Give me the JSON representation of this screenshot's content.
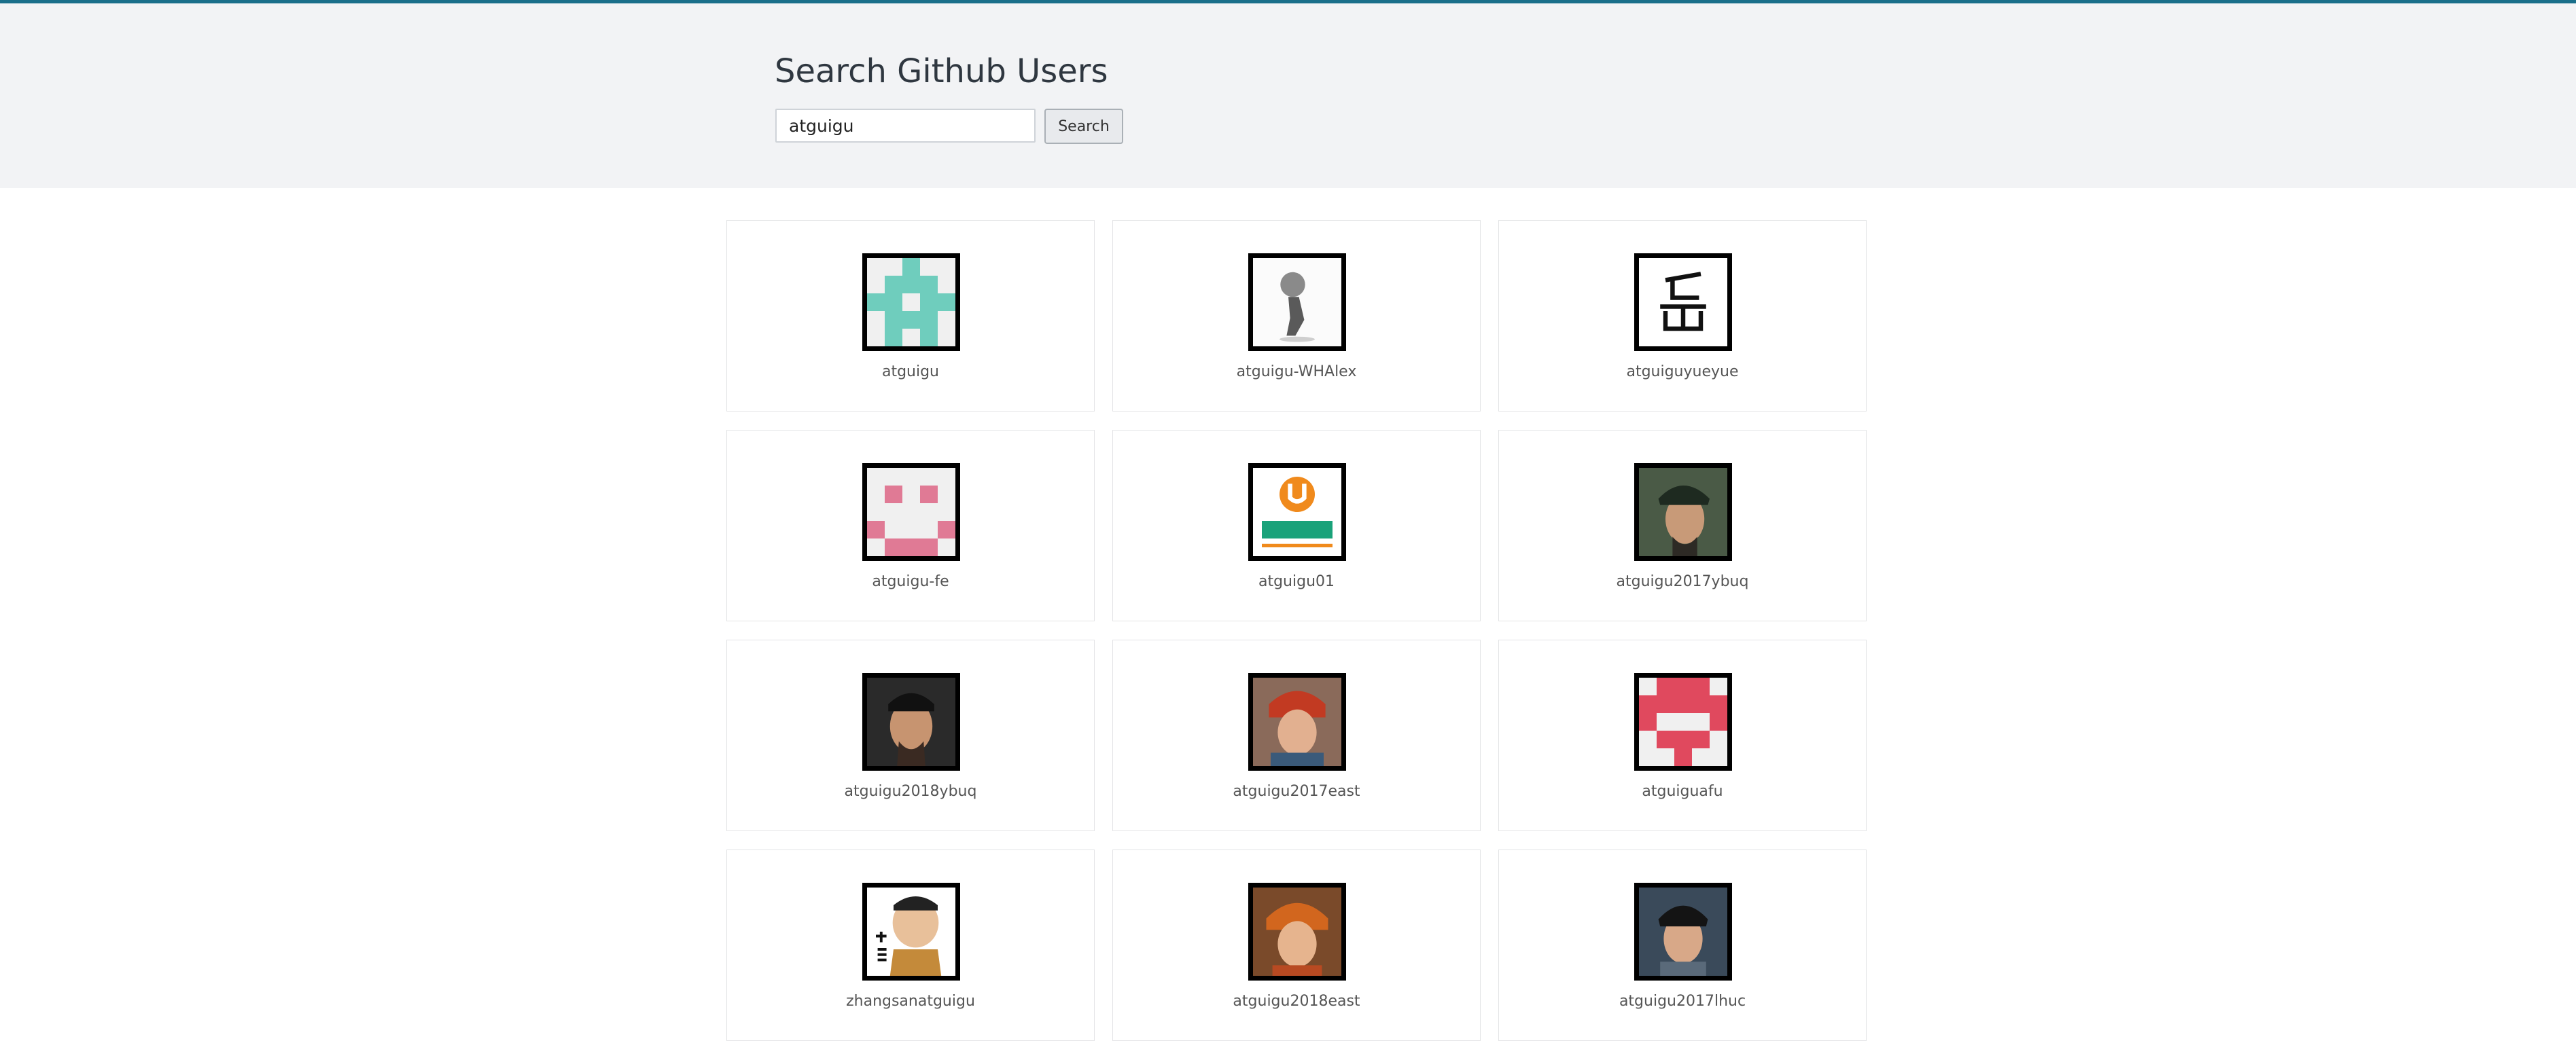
{
  "header": {
    "title": "Search Github Users",
    "search_value": "atguigu",
    "search_button": "Search"
  },
  "users": [
    {
      "login": "atguigu",
      "avatar": "identicon-teal"
    },
    {
      "login": "atguigu-WHAlex",
      "avatar": "pencil-sketch"
    },
    {
      "login": "atguiguyueyue",
      "avatar": "chinese-character"
    },
    {
      "login": "atguigu-fe",
      "avatar": "identicon-pink"
    },
    {
      "login": "atguigu01",
      "avatar": "company-logo"
    },
    {
      "login": "atguigu2017ybuq",
      "avatar": "portrait-photo"
    },
    {
      "login": "atguigu2018ybuq",
      "avatar": "portrait-photo"
    },
    {
      "login": "atguigu2017east",
      "avatar": "portrait-photo"
    },
    {
      "login": "atguiguafu",
      "avatar": "identicon-red"
    },
    {
      "login": "zhangsanatguigu",
      "avatar": "cartoon-portrait"
    },
    {
      "login": "atguigu2018east",
      "avatar": "portrait-photo"
    },
    {
      "login": "atguigu2017lhuc",
      "avatar": "portrait-photo"
    }
  ],
  "colors": {
    "topbar": "#1a6f8a",
    "jumbotron": "#f2f3f5",
    "teal": "#6fcdbd",
    "pink": "#e07a95",
    "red": "#e0495e",
    "logo_orange": "#f08a1c",
    "logo_green": "#1aa27a"
  }
}
